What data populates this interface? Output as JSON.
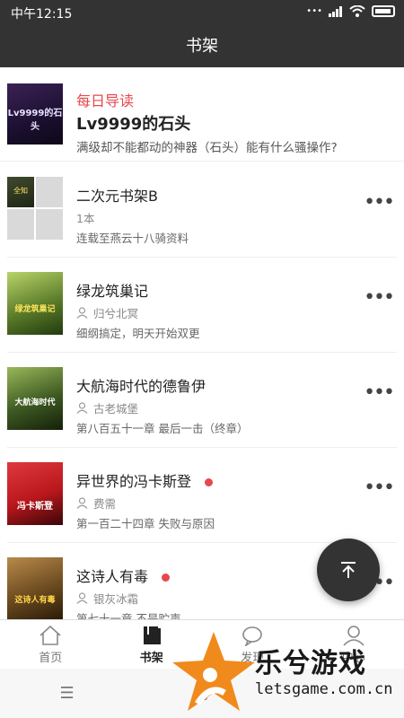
{
  "status_bar": {
    "time": "中午12:15",
    "dots": "•••"
  },
  "header": {
    "title": "书架"
  },
  "featured": {
    "tag": "每日导读",
    "title": "Lv9999的石头",
    "description": "满级却不能都动的神器（石头）能有什么骚操作?",
    "cover_text": "Lv9999的石头"
  },
  "books": [
    {
      "title": "二次元书架B",
      "meta": "1本",
      "sub": "连载至燕云十八骑资料",
      "is_folder": true,
      "cover_text": "全知",
      "more": "•••"
    },
    {
      "title": "绿龙筑巢记",
      "author": "归兮北冥",
      "sub": "细纲搞定，明天开始双更",
      "cover_text": "绿龙筑巢记",
      "cover_color": "#5c7d2a",
      "more": "•••"
    },
    {
      "title": "大航海时代的德鲁伊",
      "author": "古老城堡",
      "sub": "第八百五十一章 最后一击（终章）",
      "cover_text": "大航海时代",
      "cover_color": "#3e5a22",
      "more": "•••"
    },
    {
      "title": "异世界的冯卡斯登",
      "author": "费需",
      "sub": "第一百二十四章 失败与原因",
      "cover_text": "冯卡斯登",
      "cover_color": "#b8171c",
      "new": true,
      "more": "•••"
    },
    {
      "title": "这诗人有毒",
      "author": "银灰冰霜",
      "sub": "第七十一章 不是贮声",
      "cover_text": "这诗人有毒",
      "cover_color": "#6b4a1f",
      "new": true,
      "more": "•••"
    }
  ],
  "bottom_nav": [
    {
      "label": "首页",
      "icon": "home-icon"
    },
    {
      "label": "书架",
      "icon": "bookshelf-icon"
    },
    {
      "label": "发现",
      "icon": "discover-icon"
    },
    {
      "label": "中心",
      "icon": "profile-icon"
    }
  ],
  "system_nav": {
    "menu": "☰",
    "home": "▢"
  },
  "watermark": {
    "title": "乐兮游戏",
    "url": "letsgame.com.cn"
  },
  "colors": {
    "bar": "#333333",
    "accent_red": "#e5484d",
    "watermark_orange": "#f08a1c"
  }
}
